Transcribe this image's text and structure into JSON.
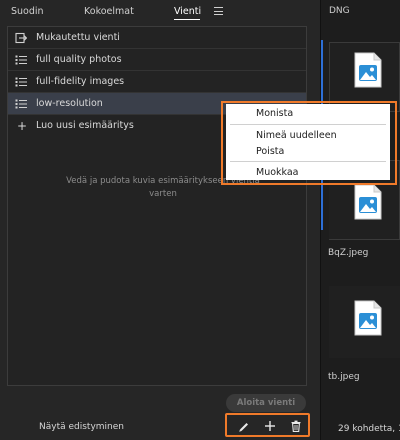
{
  "tabs": {
    "filter": "Suodin",
    "collections": "Kokoelmat",
    "export": "Vienti"
  },
  "presets": [
    {
      "label": "Mukautettu vienti",
      "icon": "export-custom-icon"
    },
    {
      "label": "full quality photos",
      "icon": "list-icon"
    },
    {
      "label": "full-fidelity images",
      "icon": "list-icon"
    },
    {
      "label": "low-resolution",
      "icon": "list-icon",
      "selected": true
    }
  ],
  "create_preset": "Luo uusi esimääritys",
  "drop_hint": "Vedä ja pudota kuvia esimääritykseen vientiä varten",
  "start_export": "Aloita vienti",
  "show_progress": "Näytä edistyminen",
  "context_menu": [
    "Monista",
    "Nimeä uudelleen",
    "Poista",
    "Muokkaa"
  ],
  "right_panel": {
    "format_label": "DNG",
    "files": [
      "BqZ.jpeg",
      "tb.jpeg"
    ],
    "count_text": "29 kohdetta, 1"
  },
  "colors": {
    "highlight": "#f07a2a",
    "selection": "#3a3f4a",
    "file_icon": "#2b8fd6"
  }
}
